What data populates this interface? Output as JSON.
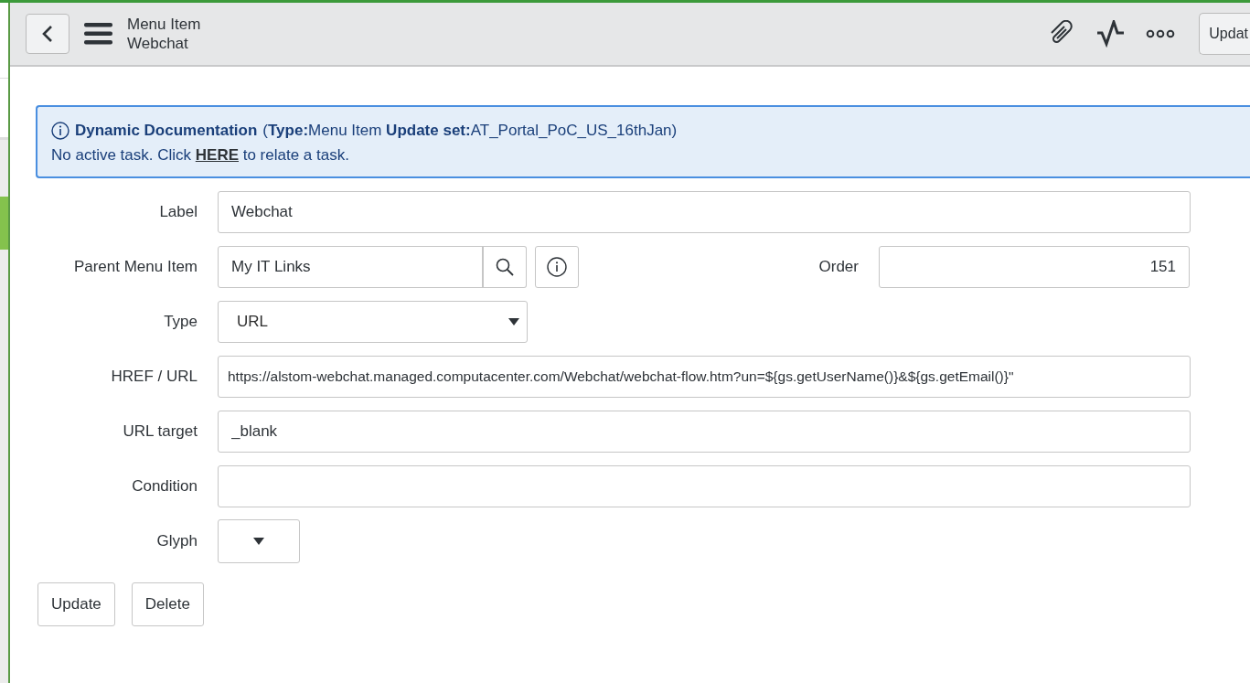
{
  "header": {
    "title": "Menu Item",
    "subtitle": "Webchat",
    "update_button": "Updat"
  },
  "doc_banner": {
    "title": "Dynamic Documentation",
    "detail": "(**Type:**Menu Item **Update set:**AT_Portal_PoC_US_16thJan)",
    "message_before": "No active task. Click ",
    "link": "HERE",
    "message_after": " to relate a task."
  },
  "fields": [
    {
      "kind": "text",
      "label": "Label",
      "value": "Webchat"
    },
    {
      "kind": "reference",
      "label": "Parent Menu Item",
      "value": "My IT Links",
      "side_label": "Order",
      "side_value": "151"
    },
    {
      "kind": "select",
      "label": "Type",
      "value": "URL"
    },
    {
      "kind": "text",
      "label": "HREF / URL",
      "value": "https://alstom-webchat.managed.computacenter.com/Webchat/webchat-flow.htm?un=${gs.getUserName()}&${gs.getEmail()}\""
    },
    {
      "kind": "text",
      "label": "URL target",
      "value": "_blank"
    },
    {
      "kind": "text",
      "label": "Condition"
    },
    {
      "kind": "glyph",
      "label": "Glyph"
    }
  ],
  "buttons": [
    "Update",
    "Delete"
  ]
}
